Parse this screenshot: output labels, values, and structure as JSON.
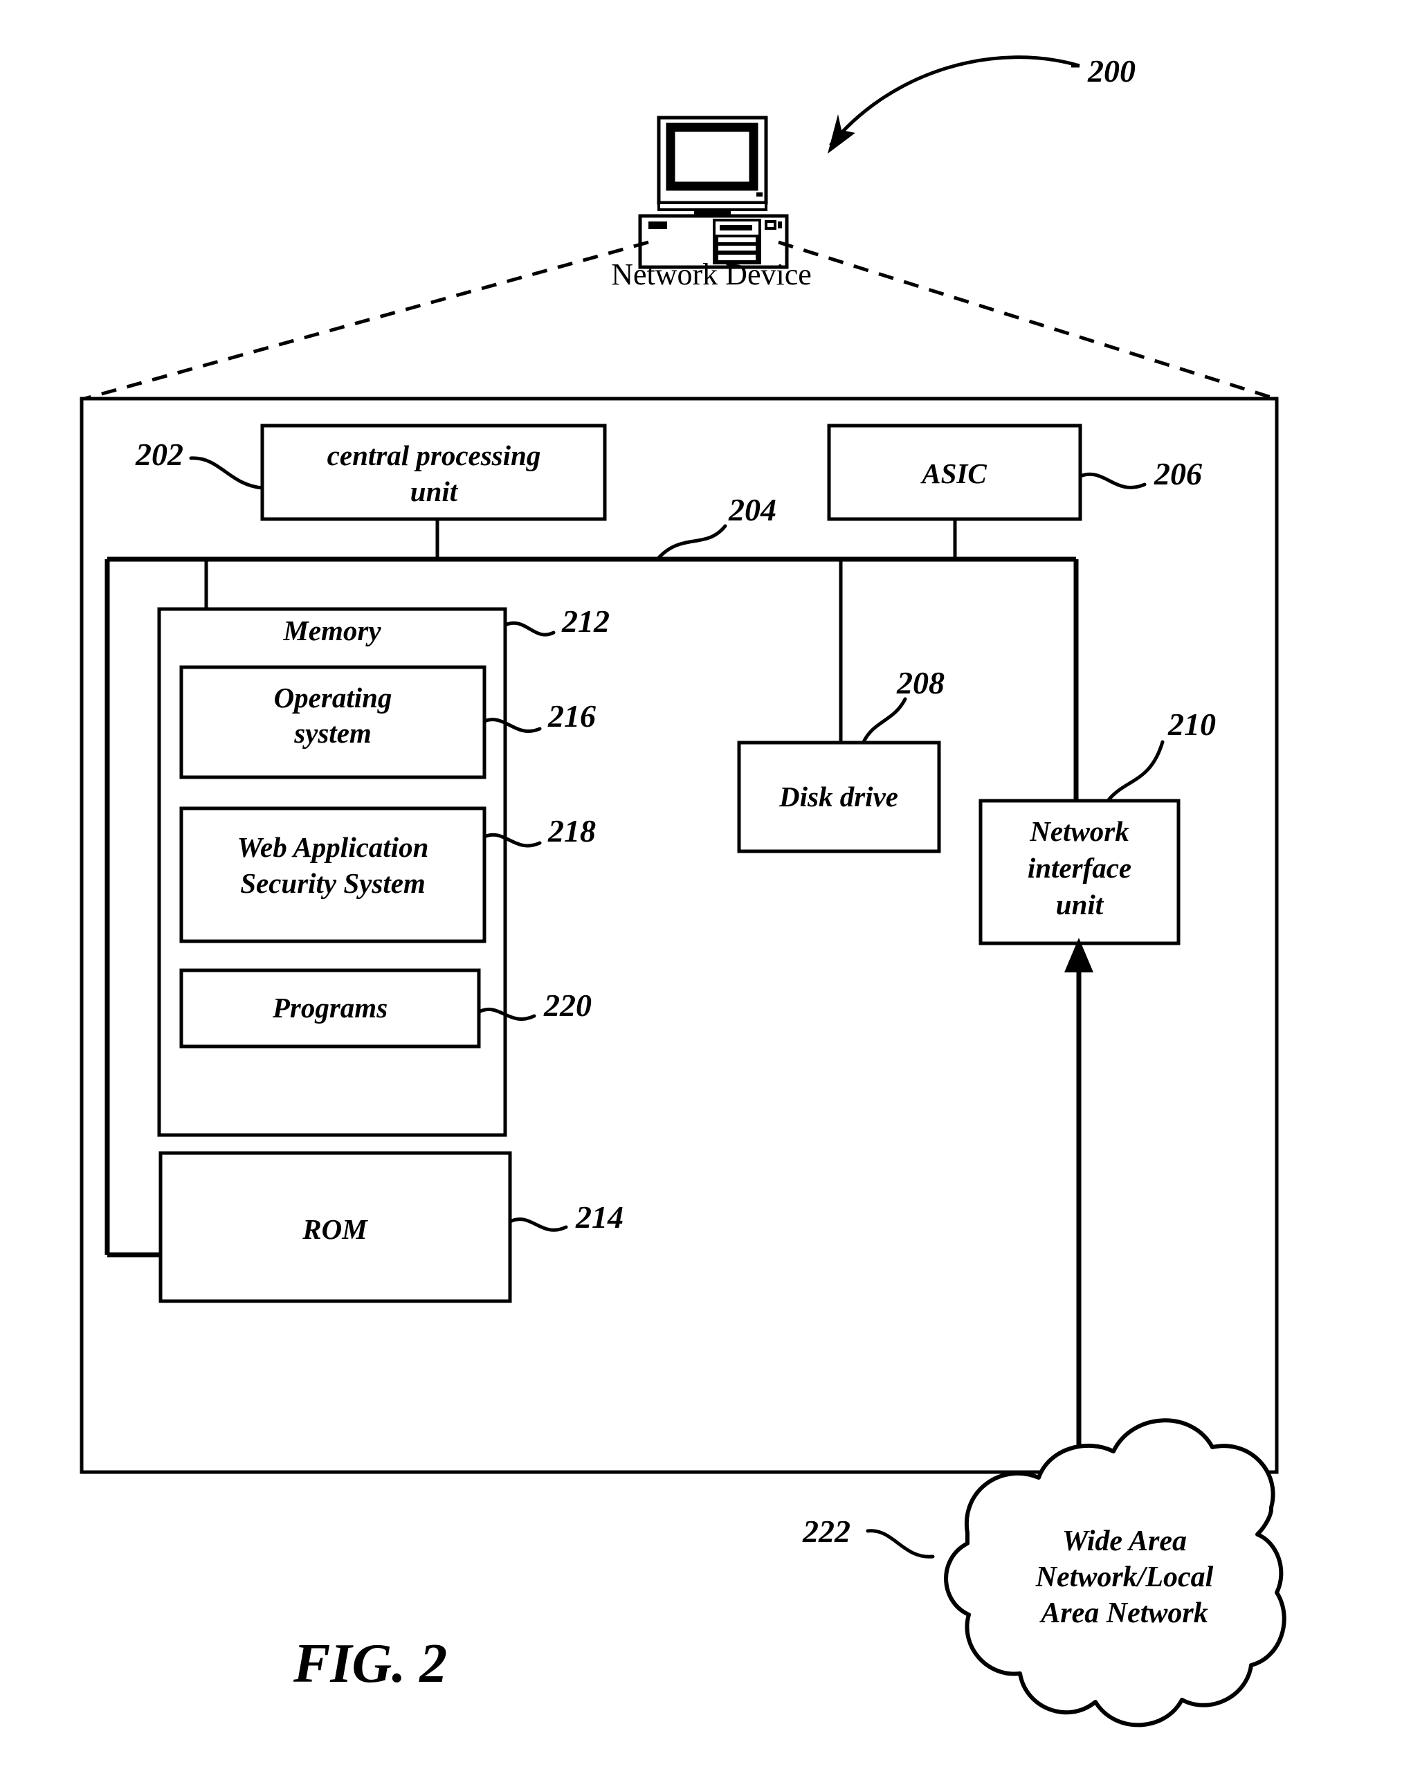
{
  "figure": {
    "caption": "FIG. 2",
    "overall_ref": "200",
    "top_label": "Network Device"
  },
  "blocks": [
    {
      "id": "cpu",
      "label_line1": "central processing",
      "label_line2": "unit",
      "ref": "202"
    },
    {
      "id": "bus",
      "label_line1": "",
      "label_line2": "",
      "ref": "204"
    },
    {
      "id": "asic",
      "label_line1": "ASIC",
      "label_line2": "",
      "ref": "206"
    },
    {
      "id": "disk",
      "label_line1": "Disk drive",
      "label_line2": "",
      "ref": "208"
    },
    {
      "id": "niu",
      "label_line1": "Network",
      "label_line2": "interface",
      "label_line3": "unit",
      "ref": "210"
    },
    {
      "id": "memory",
      "label_line1": "Memory",
      "label_line2": "",
      "ref": "212"
    },
    {
      "id": "rom",
      "label_line1": "ROM",
      "label_line2": "",
      "ref": "214"
    },
    {
      "id": "os",
      "label_line1": "Operating",
      "label_line2": "system",
      "ref": "216"
    },
    {
      "id": "wass",
      "label_line1": "Web Application",
      "label_line2": "Security System",
      "ref": "218"
    },
    {
      "id": "progs",
      "label_line1": "Programs",
      "label_line2": "",
      "ref": "220"
    },
    {
      "id": "network",
      "label_line1": "Wide Area",
      "label_line2": "Network/Local",
      "label_line3": "Area Network",
      "ref": "222"
    }
  ],
  "colors": {
    "ink": "#000000",
    "paper": "#ffffff"
  },
  "icons": {
    "computer": "desktop-computer-icon",
    "cloud": "network-cloud-icon"
  }
}
